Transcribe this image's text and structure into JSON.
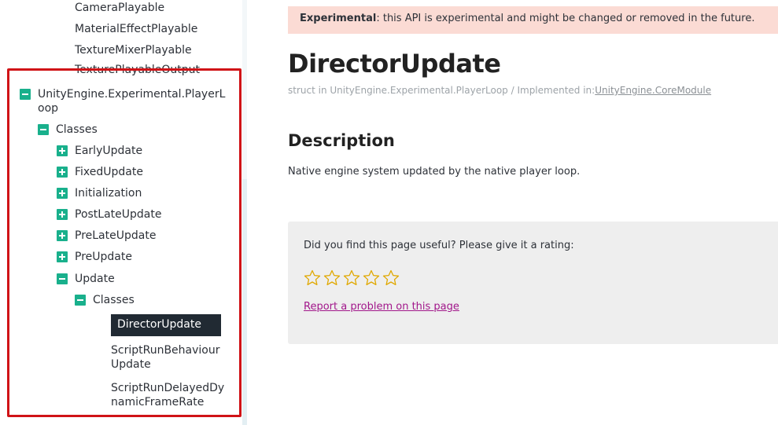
{
  "sidebar": {
    "top_items": [
      "CameraPlayable",
      "MaterialEffectPlayable",
      "TextureMixerPlayable",
      "TexturePlayableOutput"
    ],
    "namespace_line1": "UnityEngine.Experimental.PlayerL",
    "namespace_line2": "oop",
    "classes_label": "Classes",
    "class_items": [
      "EarlyUpdate",
      "FixedUpdate",
      "Initialization",
      "PostLateUpdate",
      "PreLateUpdate",
      "PreUpdate"
    ],
    "update_label": "Update",
    "update_classes_label": "Classes",
    "selected_item": "DirectorUpdate",
    "item_script_run_1": "ScriptRunBehaviour",
    "item_script_run_2": "Update",
    "item_delayed_1": "ScriptRunDelayedDy",
    "item_delayed_2": "namicFrameRate"
  },
  "banner": {
    "bold": "Experimental",
    "text": ": this API is experimental and might be changed or removed in the future."
  },
  "page": {
    "title": "DirectorUpdate",
    "subline_prefix": "struct in UnityEngine.Experimental.PlayerLoop  /  Implemented in:",
    "subline_link": "UnityEngine.CoreModule",
    "description_heading": "Description",
    "description_text": "Native engine system updated by the native player loop."
  },
  "feedback": {
    "question": "Did you find this page useful? Please give it a rating:",
    "rating": 0,
    "max_rating": 5,
    "report_link": "Report a problem on this page"
  },
  "colors": {
    "tree_toggle": "#19b08c",
    "selected_bg": "#212a33",
    "banner_bg": "#fbdbd4",
    "highlight_border": "#d01317",
    "star": "#e0a800",
    "report_link": "#a1168a"
  },
  "icons": {
    "expand": "plus-icon",
    "collapse": "minus-icon",
    "rating": "star-outline-icon"
  }
}
